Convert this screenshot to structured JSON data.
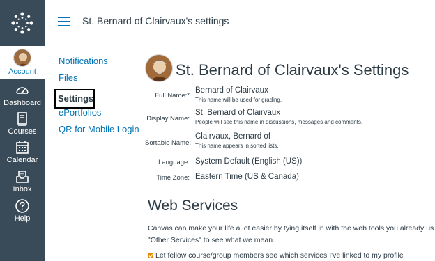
{
  "header": {
    "breadcrumb": "St. Bernard of Clairvaux's settings"
  },
  "global_nav": {
    "items": [
      {
        "label": "Account",
        "icon": "avatar"
      },
      {
        "label": "Dashboard",
        "icon": "speedometer-icon"
      },
      {
        "label": "Courses",
        "icon": "book-icon"
      },
      {
        "label": "Calendar",
        "icon": "calendar-icon"
      },
      {
        "label": "Inbox",
        "icon": "inbox-icon"
      },
      {
        "label": "Help",
        "icon": "question-circle-icon"
      }
    ]
  },
  "subnav": {
    "items": [
      {
        "label": "Notifications"
      },
      {
        "label": "Files"
      },
      {
        "label": "Settings"
      },
      {
        "label": "ePortfolios"
      },
      {
        "label": "QR for Mobile Login"
      }
    ]
  },
  "profile": {
    "title": "St. Bernard of Clairvaux's Settings",
    "fields": [
      {
        "label": "Full Name:*",
        "value": "Bernard of Clairvaux",
        "hint": "This name will be used for grading."
      },
      {
        "label": "Display Name:",
        "value": "St. Bernard of Clairvaux",
        "hint": "People will see this name in discussions, messages and comments."
      },
      {
        "label": "Sortable Name:",
        "value": "Clairvaux, Bernard of",
        "hint": "This name appears in sorted lists."
      },
      {
        "label": "Language:",
        "value": "System Default (English (US))"
      },
      {
        "label": "Time Zone:",
        "value": "Eastern Time (US & Canada)"
      }
    ]
  },
  "web_services": {
    "title": "Web Services",
    "paragraph_line1": "Canvas can make your life a lot easier by tying itself in with the web tools you already us",
    "paragraph_line2": "\"Other Services\" to see what we mean.",
    "checkbox_label": "Let fellow course/group members see which services I've linked to my profile",
    "checkbox_checked": true
  },
  "colors": {
    "nav_bg": "#394b58",
    "link": "#0374b5",
    "text": "#2d3b45",
    "checkbox": "#e68a00"
  }
}
